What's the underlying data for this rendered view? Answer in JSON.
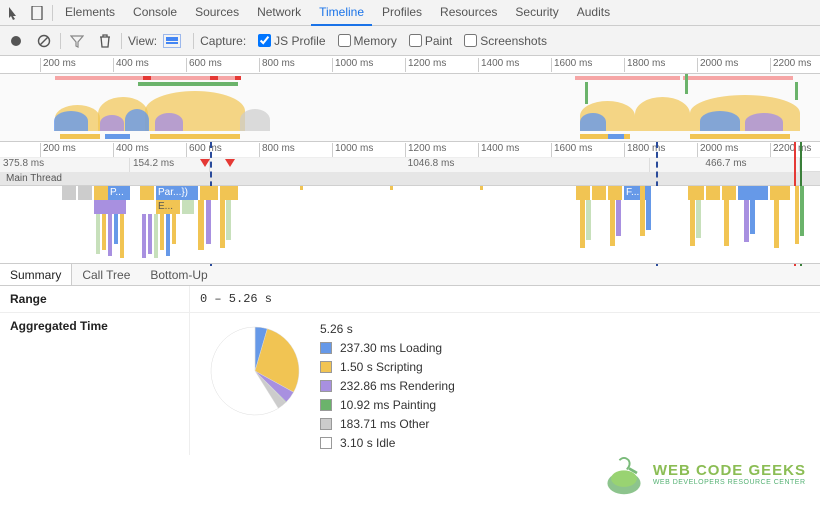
{
  "tabs": [
    "Elements",
    "Console",
    "Sources",
    "Network",
    "Timeline",
    "Profiles",
    "Resources",
    "Security",
    "Audits"
  ],
  "active_tab": "Timeline",
  "toolbar": {
    "view_label": "View:",
    "capture_label": "Capture:",
    "options": [
      {
        "label": "JS Profile",
        "checked": true
      },
      {
        "label": "Memory",
        "checked": false
      },
      {
        "label": "Paint",
        "checked": false
      },
      {
        "label": "Screenshots",
        "checked": false
      }
    ]
  },
  "ruler_ticks": [
    "200 ms",
    "400 ms",
    "600 ms",
    "800 ms",
    "1000 ms",
    "1200 ms",
    "1400 ms",
    "1600 ms",
    "1800 ms",
    "2000 ms",
    "2200 ms"
  ],
  "frame_times": [
    "375.8 ms",
    "154.2 ms",
    "1046.8 ms",
    "466.7 ms"
  ],
  "main_thread_label": "Main Thread",
  "flame_labels": {
    "p": "P...",
    "par": "Par...})",
    "e": "E...",
    "f": "F..."
  },
  "summary_tabs": [
    "Summary",
    "Call Tree",
    "Bottom-Up"
  ],
  "active_summary_tab": "Summary",
  "range": {
    "label": "Range",
    "value": "0 – 5.26 s"
  },
  "aggregated": {
    "label": "Aggregated Time",
    "total": "5.26 s",
    "items": [
      {
        "color": "#6699e8",
        "text": "237.30 ms Loading"
      },
      {
        "color": "#f1c453",
        "text": "1.50 s Scripting"
      },
      {
        "color": "#a890e0",
        "text": "232.86 ms Rendering"
      },
      {
        "color": "#6bb36b",
        "text": "10.92 ms Painting"
      },
      {
        "color": "#cccccc",
        "text": "183.71 ms Other"
      },
      {
        "color": "#ffffff",
        "text": "3.10 s Idle"
      }
    ]
  },
  "chart_data": {
    "type": "pie",
    "title": "Aggregated Time",
    "total_seconds": 5.26,
    "series": [
      {
        "name": "Loading",
        "value_ms": 237.3,
        "color": "#6699e8"
      },
      {
        "name": "Scripting",
        "value_ms": 1500.0,
        "color": "#f1c453"
      },
      {
        "name": "Rendering",
        "value_ms": 232.86,
        "color": "#a890e0"
      },
      {
        "name": "Painting",
        "value_ms": 10.92,
        "color": "#6bb36b"
      },
      {
        "name": "Other",
        "value_ms": 183.71,
        "color": "#cccccc"
      },
      {
        "name": "Idle",
        "value_ms": 3100.0,
        "color": "#ffffff"
      }
    ]
  },
  "watermark": {
    "line1": "WEB CODE GEEKS",
    "line2": "WEB DEVELOPERS RESOURCE CENTER"
  }
}
